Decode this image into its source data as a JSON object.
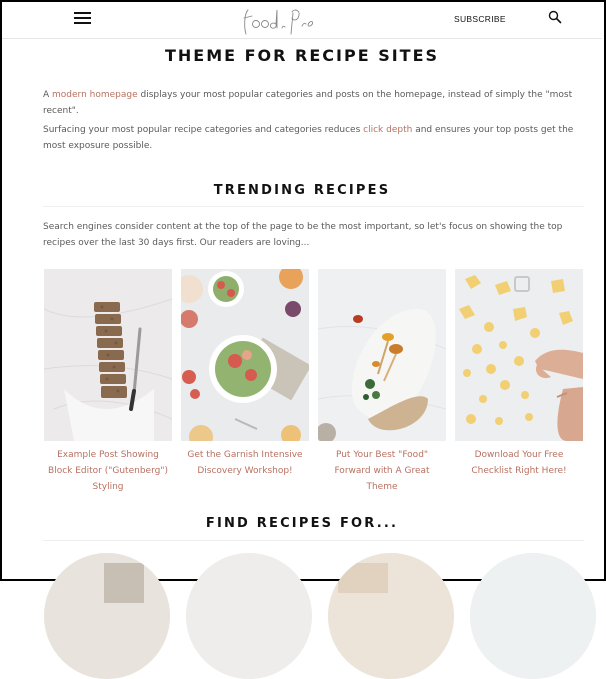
{
  "header": {
    "logo_text": "Foodie Pro",
    "subscribe_label": "SUBSCRIBE",
    "menu_icon": "hamburger-menu-icon",
    "search_icon": "search-icon"
  },
  "main": {
    "title": "THEME FOR RECIPE SITES",
    "para1": {
      "before": "A ",
      "link": "modern homepage",
      "after": " displays your most popular categories and posts on the homepage, instead of simply the \"most recent\"."
    },
    "para2": {
      "before": "Surfacing your most popular recipe categories and categories reduces ",
      "link": "click depth",
      "after": " and ensures your top posts get the most exposure possible."
    },
    "trending": {
      "heading": "TRENDING RECIPES",
      "intro": "Search engines consider content at the top of the page to be the most important, so let's focus on showing the top recipes over the last 30 days first. Our readers are loving...",
      "cards": [
        {
          "caption": "Example Post Showing Block Editor (\"Gutenberg\") Styling"
        },
        {
          "caption": "Get the Garnish Intensive Discovery Workshop!"
        },
        {
          "caption": "Put Your Best \"Food\" Forward with A Great Theme"
        },
        {
          "caption": "Download Your Free Checklist Right Here!"
        }
      ]
    },
    "find": {
      "heading": "FIND RECIPES FOR..."
    }
  },
  "colors": {
    "accent_link": "#b87162",
    "heading": "#111111",
    "body_text": "#5a5a5a"
  }
}
